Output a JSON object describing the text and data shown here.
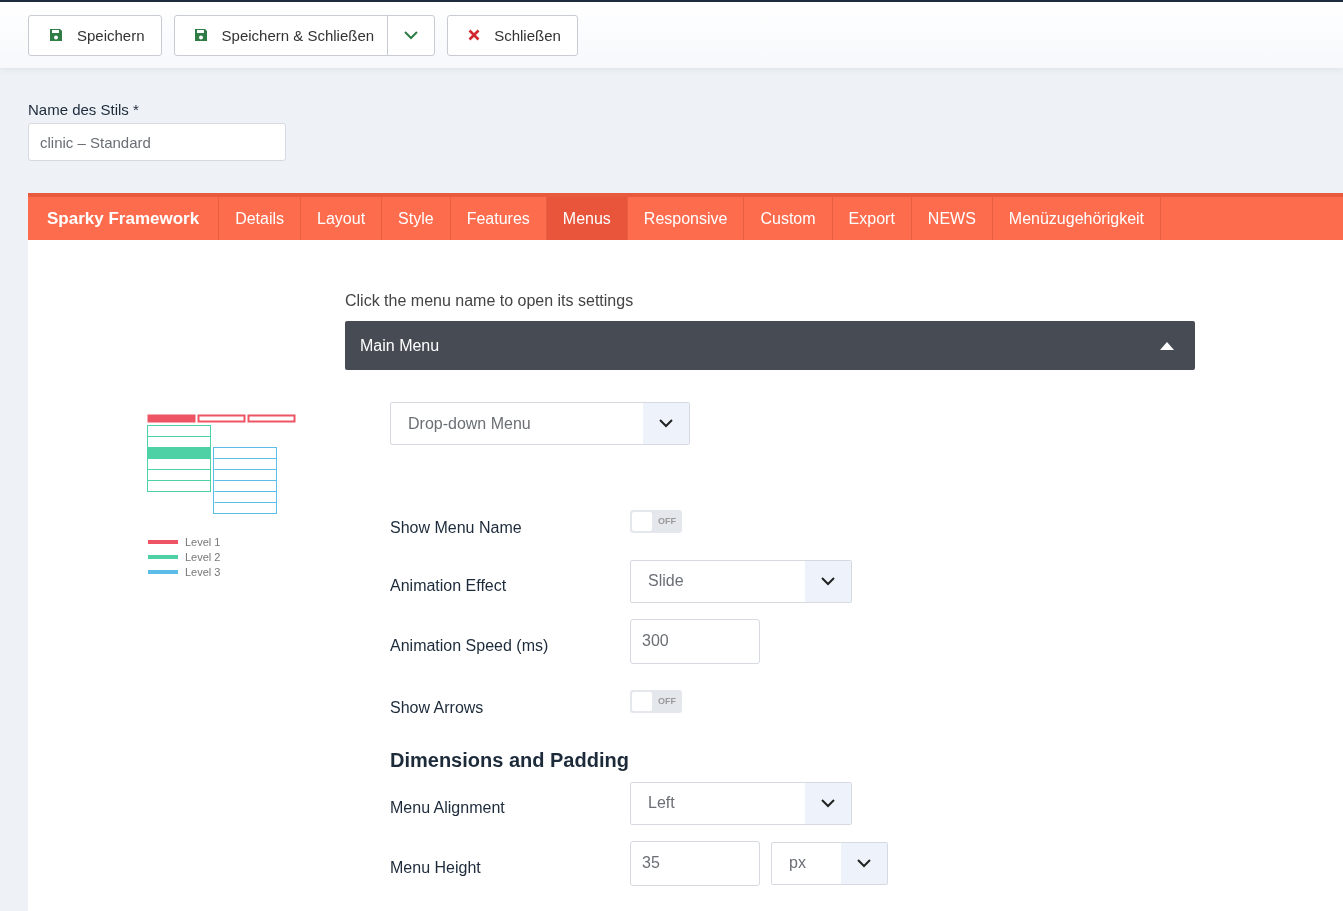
{
  "toolbar": {
    "buttons": [
      {
        "kind": "save",
        "label": "Speichern"
      },
      {
        "kind": "save-close",
        "label": "Speichern & Schließen"
      },
      {
        "kind": "close",
        "label": "Schließen"
      }
    ]
  },
  "style_name": {
    "label": "Name des Stils *",
    "value": "clinic – Standard"
  },
  "tabs": {
    "brand": "Sparky Framework",
    "items": [
      {
        "label": "Details",
        "selected": false
      },
      {
        "label": "Layout",
        "selected": false
      },
      {
        "label": "Style",
        "selected": false
      },
      {
        "label": "Features",
        "selected": false
      },
      {
        "label": "Menus",
        "selected": true
      },
      {
        "label": "Responsive",
        "selected": false
      },
      {
        "label": "Custom",
        "selected": false
      },
      {
        "label": "Export",
        "selected": false
      },
      {
        "label": "NEWS",
        "selected": false
      },
      {
        "label": "Menüzugehörigkeit",
        "selected": false
      }
    ]
  },
  "legend": [
    {
      "label": "Level 1",
      "color": "#ee5464"
    },
    {
      "label": "Level 2",
      "color": "#4fd1a6"
    },
    {
      "label": "Level 3",
      "color": "#5bbde8"
    }
  ],
  "hint": "Click the menu name to open its settings",
  "menu": {
    "title": "Main Menu",
    "expanded": true,
    "type_select": "Drop-down Menu",
    "settings": [
      {
        "kind": "toggle",
        "label": "Show Menu Name",
        "on": false,
        "state_text": "OFF"
      },
      {
        "kind": "select",
        "label": "Animation Effect",
        "value": "Slide"
      },
      {
        "kind": "input",
        "label": "Animation Speed (ms)",
        "value": "300"
      },
      {
        "kind": "toggle",
        "label": "Show Arrows",
        "on": false,
        "state_text": "OFF"
      },
      {
        "kind": "heading",
        "label": "Dimensions and Padding"
      },
      {
        "kind": "select",
        "label": "Menu Alignment",
        "value": "Left"
      },
      {
        "kind": "unit",
        "label": "Menu Height",
        "value": "35",
        "unit": "px"
      }
    ]
  }
}
